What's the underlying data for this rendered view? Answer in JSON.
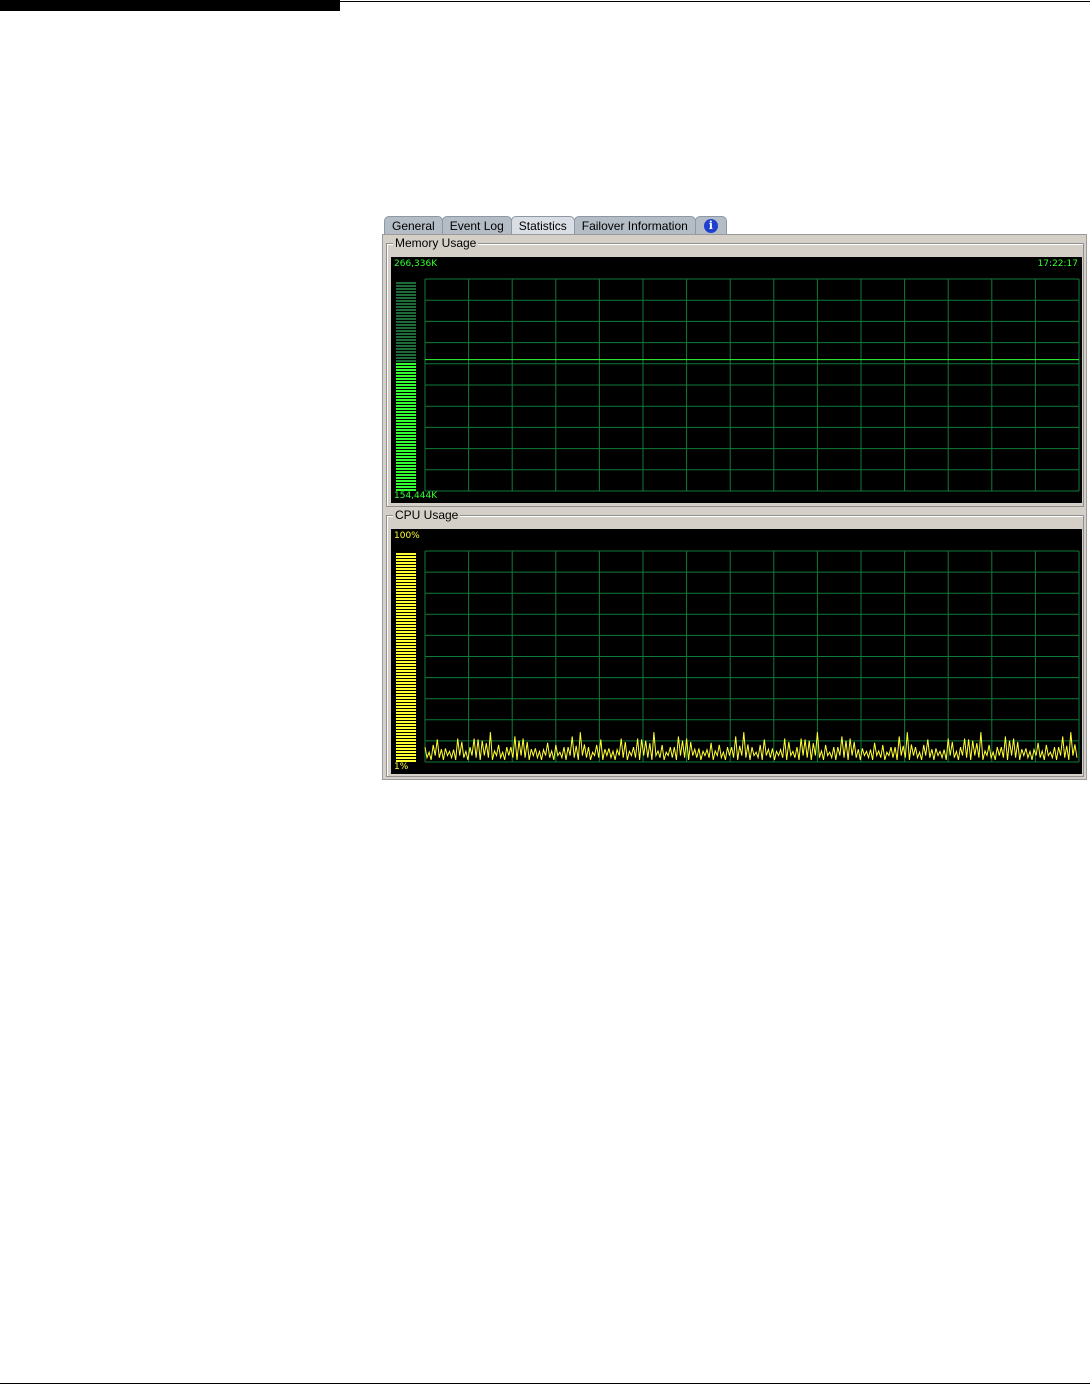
{
  "tabs": [
    {
      "label": "General",
      "active": false
    },
    {
      "label": "Event Log",
      "active": false
    },
    {
      "label": "Statistics",
      "active": true
    },
    {
      "label": "Failover Information",
      "active": false
    }
  ],
  "info_icon": "info-icon",
  "memory": {
    "title": "Memory Usage",
    "max_label": "266,336K",
    "min_label": "154,444K",
    "time_label": "17:22:17",
    "color": "#33ff33"
  },
  "cpu": {
    "title": "CPU Usage",
    "max_label": "100%",
    "min_label": "1%",
    "color": "#ffff33"
  },
  "chart_data": [
    {
      "type": "line",
      "title": "Memory Usage",
      "ylim_labels": [
        "154,444K",
        "266,336K"
      ],
      "current_level": 0.62,
      "series": [
        {
          "values": [
            0.62,
            0.62,
            0.62,
            0.62,
            0.62,
            0.62,
            0.62,
            0.62,
            0.62,
            0.62
          ]
        }
      ]
    },
    {
      "type": "line",
      "title": "CPU Usage",
      "ylim": [
        1,
        100
      ],
      "current_level": 4,
      "series": [
        {
          "values": [
            8,
            12,
            6,
            14,
            9,
            5,
            16,
            10,
            7,
            13,
            9,
            15,
            6,
            11,
            8,
            41,
            12,
            7,
            14,
            9,
            6,
            15,
            10,
            8,
            12,
            7,
            16,
            9,
            11,
            6,
            13,
            8,
            15,
            10,
            7,
            12,
            9,
            14,
            6,
            11,
            8,
            16,
            10,
            7,
            13,
            9,
            15,
            6,
            12,
            8,
            14,
            10,
            7,
            11,
            9,
            16,
            6,
            13,
            8,
            12,
            10,
            15,
            7,
            11,
            9,
            14,
            6,
            12,
            8,
            16,
            10,
            7,
            13,
            9,
            11,
            6,
            15,
            8,
            12,
            10
          ]
        }
      ]
    }
  ]
}
